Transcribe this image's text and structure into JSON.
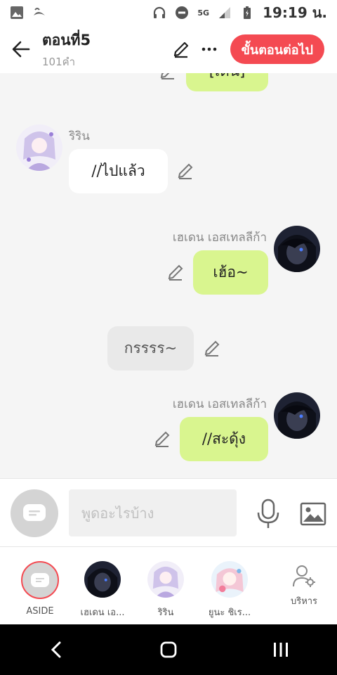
{
  "status_bar": {
    "network": "5G",
    "time": "19:19 น."
  },
  "header": {
    "title": "ตอนที่5",
    "subtitle": "101คำ",
    "next_button": "ขั้นตอนต่อไป"
  },
  "chat": {
    "messages": [
      {
        "speaker": "",
        "text": "[เดิน]",
        "style": "green"
      },
      {
        "speaker": "ริริน",
        "text": "//ไปแล้ว",
        "style": "white"
      },
      {
        "speaker": "เฮเดน เอสเทลลีก้า",
        "text": "เฮ้อ~",
        "style": "green"
      },
      {
        "speaker": "",
        "text": "กรรรร~",
        "style": "grey"
      },
      {
        "speaker": "เฮเดน เอสเทลลีก้า",
        "text": "//สะดุ้ง",
        "style": "green"
      }
    ]
  },
  "input": {
    "placeholder": "พูดอะไรบ้าง"
  },
  "characters": [
    {
      "label": "ASIDE",
      "icon": "chat-icon",
      "selected": true
    },
    {
      "label": "เฮเดน เอ...",
      "icon": "avatar"
    },
    {
      "label": "ริริน",
      "icon": "avatar"
    },
    {
      "label": "ยูนะ ชิเร...",
      "icon": "avatar"
    },
    {
      "label": "บริหาร",
      "icon": "user-gear-icon"
    }
  ],
  "colors": {
    "accent": "#f44a52",
    "green_bubble": "#d9f58f",
    "white_bubble": "#ffffff",
    "grey_bubble": "#e9e9e9"
  }
}
